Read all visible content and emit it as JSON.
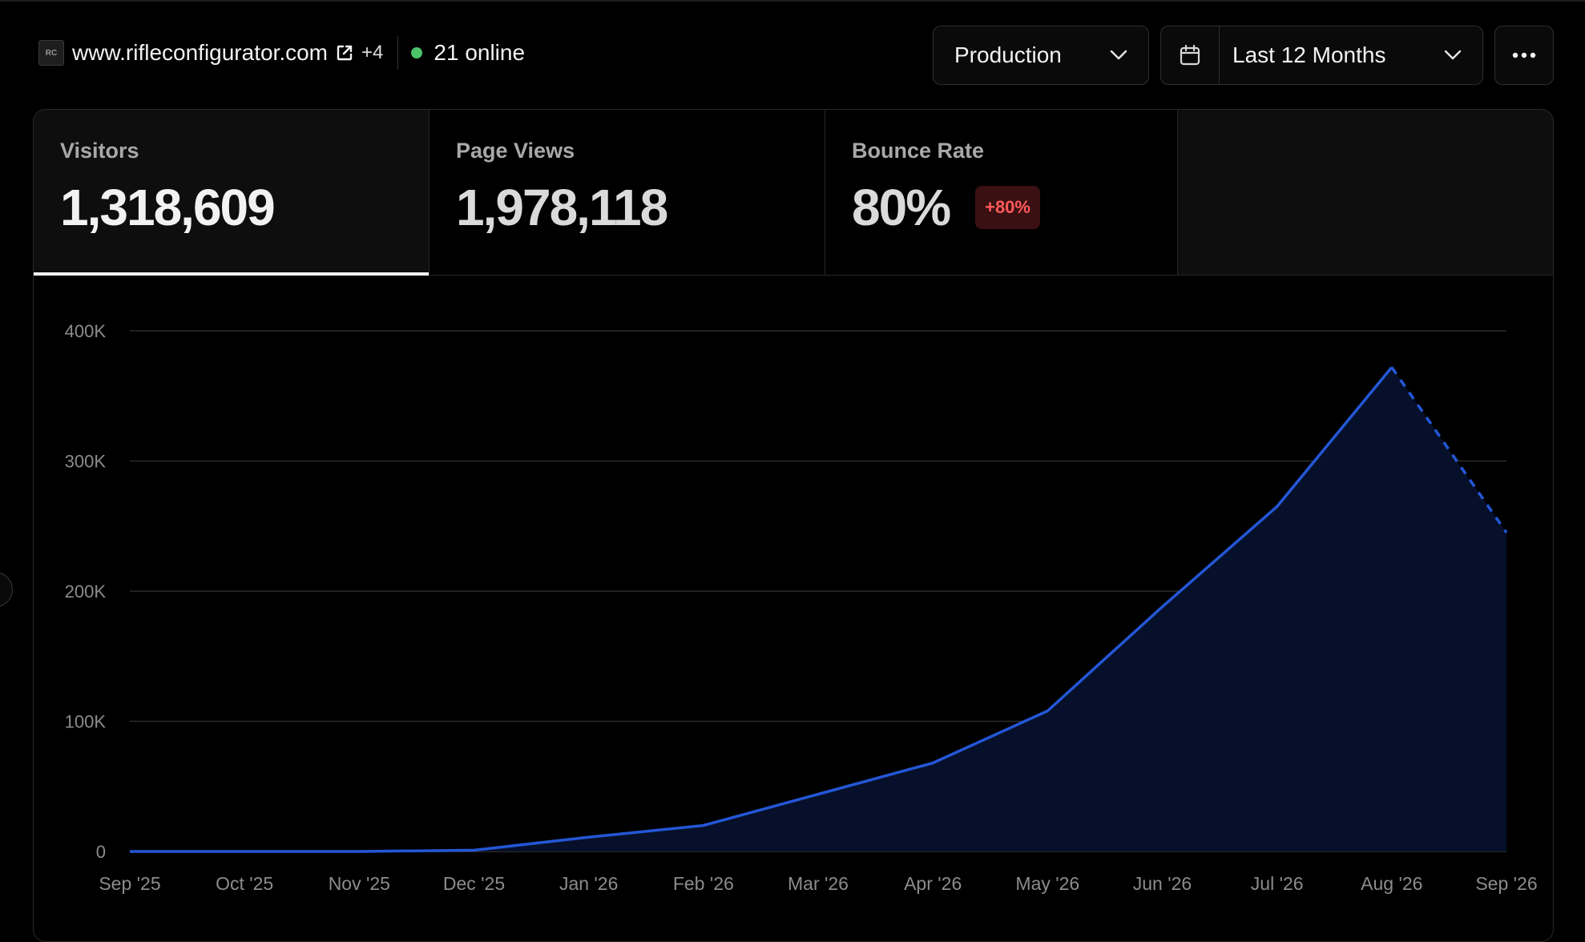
{
  "header": {
    "favicon_text": "RC",
    "domain": "www.rifleconfigurator.com",
    "extra_domains": "+4",
    "online": "21 online"
  },
  "controls": {
    "environment": "Production",
    "date_range": "Last 12 Months"
  },
  "tabs": [
    {
      "label": "Visitors",
      "value": "1,318,609"
    },
    {
      "label": "Page Views",
      "value": "1,978,118"
    },
    {
      "label": "Bounce Rate",
      "value": "80%",
      "badge": "+80%"
    }
  ],
  "colors": {
    "accent": "#2457d6",
    "online": "#4cc36b",
    "badge_bg": "#3a1012",
    "badge_text": "#ff5a5a",
    "area_fill": "#06102a"
  },
  "chart_data": {
    "type": "area",
    "x": [
      "Sep '25",
      "Oct '25",
      "Nov '25",
      "Dec '25",
      "Jan '26",
      "Feb '26",
      "Mar '26",
      "Apr '26",
      "May '26",
      "Jun '26",
      "Jul '26",
      "Aug '26",
      "Sep '26"
    ],
    "values": [
      0,
      0,
      0,
      1000,
      11000,
      20000,
      44000,
      68000,
      108000,
      188000,
      265000,
      372000,
      245000
    ],
    "projected_last": true,
    "yticks": [
      0,
      100000,
      200000,
      300000,
      400000
    ],
    "ytick_labels": [
      "0",
      "100K",
      "200K",
      "300K",
      "400K"
    ],
    "ylim": [
      0,
      400000
    ],
    "grid": true,
    "legend": "none"
  }
}
